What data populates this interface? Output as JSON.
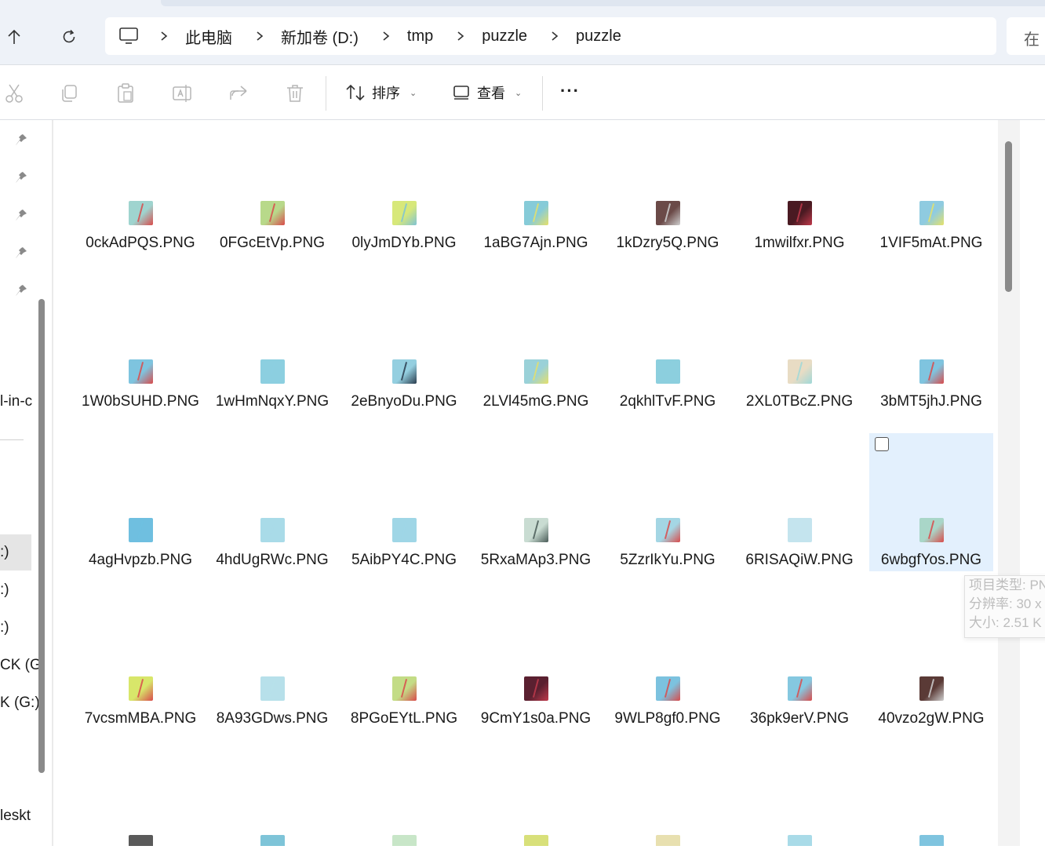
{
  "address_bar": {
    "breadcrumbs": [
      "此电脑",
      "新加卷 (D:)",
      "tmp",
      "puzzle",
      "puzzle"
    ],
    "search_partial": "在"
  },
  "toolbar": {
    "sort_label": "排序",
    "view_label": "查看"
  },
  "sidebar": {
    "labels": [
      "l-in-c",
      ":)",
      ":)",
      ":)",
      "CK (G",
      "K (G:)",
      "leskt"
    ]
  },
  "files": [
    {
      "name": "0ckAdPQS.PNG",
      "thumb_color": "#9fd4cf",
      "accent": "#d94b4b"
    },
    {
      "name": "0FGcEtVp.PNG",
      "thumb_color": "#b8d98a",
      "accent": "#d94b4b"
    },
    {
      "name": "0lyJmDYb.PNG",
      "thumb_color": "#d7e87a",
      "accent": "#7fc3d4"
    },
    {
      "name": "1aBG7Ajn.PNG",
      "thumb_color": "#86cbd8",
      "accent": "#e6e06a"
    },
    {
      "name": "1kDzry5Q.PNG",
      "thumb_color": "#6b4a48",
      "accent": "#cfcfcf"
    },
    {
      "name": "1mwilfxr.PNG",
      "thumb_color": "#4a1a22",
      "accent": "#c0394b"
    },
    {
      "name": "1VIF5mAt.PNG",
      "thumb_color": "#8fcbe0",
      "accent": "#e5e26a"
    },
    {
      "name": "1W0bSUHD.PNG",
      "thumb_color": "#7ec4df",
      "accent": "#d94b4b"
    },
    {
      "name": "1wHmNqxY.PNG",
      "thumb_color": "#8ccfe0",
      "accent": "#8ccfe0"
    },
    {
      "name": "2eBnyoDu.PNG",
      "thumb_color": "#94cfe0",
      "accent": "#2a3c4d"
    },
    {
      "name": "2LVl45mG.PNG",
      "thumb_color": "#9ad1d8",
      "accent": "#e5df6a"
    },
    {
      "name": "2qkhlTvF.PNG",
      "thumb_color": "#8ccfde",
      "accent": "#8ccfde"
    },
    {
      "name": "2XL0TBcZ.PNG",
      "thumb_color": "#e8dcc4",
      "accent": "#9fd8d8"
    },
    {
      "name": "3bMT5jhJ.PNG",
      "thumb_color": "#7fc4df",
      "accent": "#d94b4b"
    },
    {
      "name": "4agHvpzb.PNG",
      "thumb_color": "#6fbfe0",
      "accent": "#6fbfe0"
    },
    {
      "name": "4hdUgRWc.PNG",
      "thumb_color": "#a9dbe8",
      "accent": "#a9dbe8"
    },
    {
      "name": "5AibPY4C.PNG",
      "thumb_color": "#9fd6e6",
      "accent": "#9fd6e6"
    },
    {
      "name": "5RxaMAp3.PNG",
      "thumb_color": "#c9dcd2",
      "accent": "#4a5c58"
    },
    {
      "name": "5ZzrIkYu.PNG",
      "thumb_color": "#a4d6e4",
      "accent": "#d94b4b"
    },
    {
      "name": "6RISAQiW.PNG",
      "thumb_color": "#c4e4ee",
      "accent": "#c4e4ee"
    },
    {
      "name": "6wbgfYos.PNG",
      "thumb_color": "#a9d6c8",
      "accent": "#d94b4b"
    },
    {
      "name": "7vcsmMBA.PNG",
      "thumb_color": "#d8e66a",
      "accent": "#d94b4b"
    },
    {
      "name": "8A93GDws.PNG",
      "thumb_color": "#b7e0ea",
      "accent": "#b7e0ea"
    },
    {
      "name": "8PGoEYtL.PNG",
      "thumb_color": "#c3dc86",
      "accent": "#d94b4b"
    },
    {
      "name": "9CmY1s0a.PNG",
      "thumb_color": "#5a2030",
      "accent": "#c0394b"
    },
    {
      "name": "9WLP8gf0.PNG",
      "thumb_color": "#7cc2df",
      "accent": "#d94b4b"
    },
    {
      "name": "36pk9erV.PNG",
      "thumb_color": "#85c8e0",
      "accent": "#d94b4b"
    },
    {
      "name": "40vzo2gW.PNG",
      "thumb_color": "#5a3a36",
      "accent": "#cfcfcf"
    }
  ],
  "partial_row_thumbs": [
    "#5a5a5a",
    "#7ec4d8",
    "#c8e6c8",
    "#d8e07a",
    "#e8e0b0",
    "#a9dbe8",
    "#7fc4df"
  ],
  "selected_file_index": 20,
  "tooltip": {
    "lines": [
      "项目类型: PN",
      "分辨率: 30 x",
      "大小: 2.51 K"
    ]
  }
}
